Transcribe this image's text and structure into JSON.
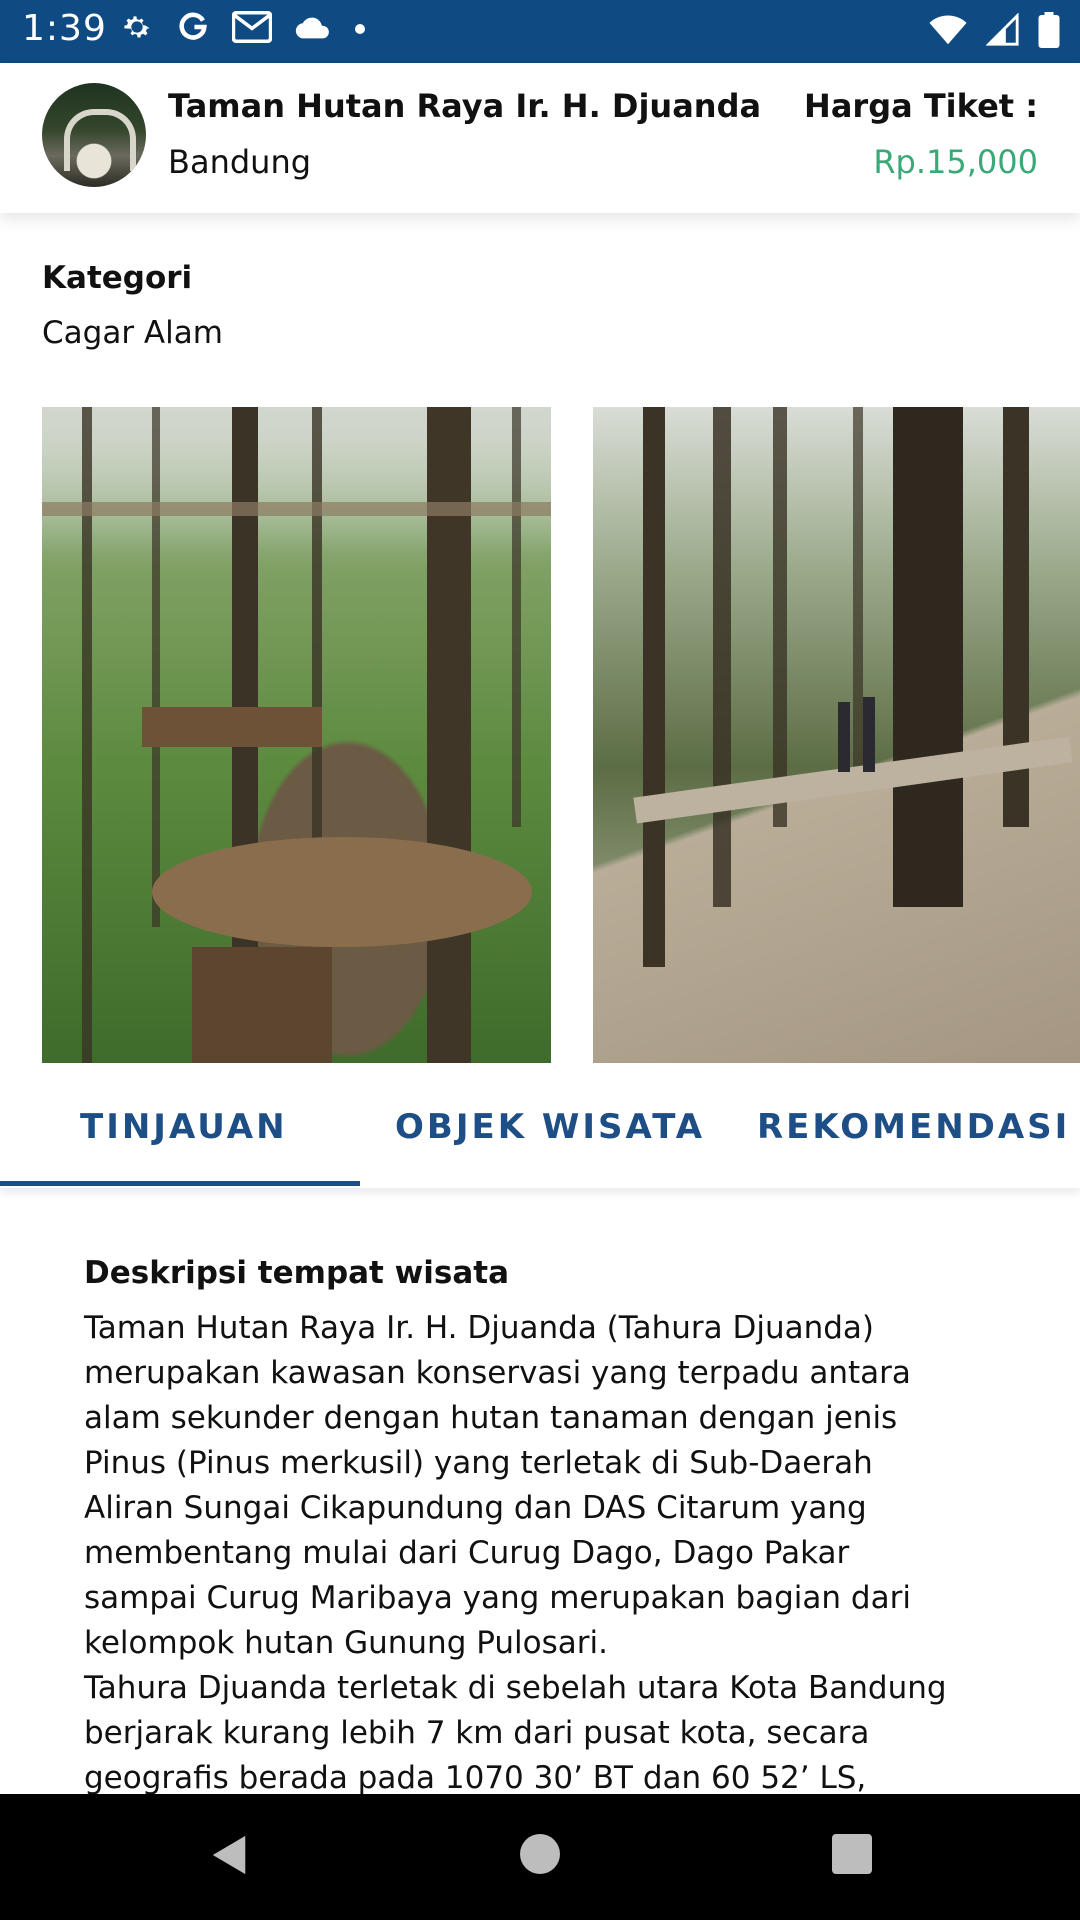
{
  "status_bar": {
    "time": "1:39",
    "icons_left": [
      "gear-icon",
      "google-icon",
      "gmail-icon",
      "cloud-icon",
      "dot-icon"
    ],
    "icons_right": [
      "wifi-icon",
      "signal-icon",
      "battery-icon"
    ],
    "background": "#0f4a82"
  },
  "header": {
    "title": "Taman Hutan Raya Ir. H. Djuanda",
    "city": "Bandung",
    "price_label": "Harga Tiket :",
    "price_value": "Rp.15,000",
    "price_color": "#3aa877"
  },
  "category": {
    "label": "Kategori",
    "value": "Cagar Alam"
  },
  "tabs": [
    {
      "label": "TINJAUAN",
      "active": true
    },
    {
      "label": "OBJEK WISATA",
      "active": false
    },
    {
      "label": "REKOMENDASI",
      "active": false
    }
  ],
  "description": {
    "title": "Deskripsi tempat wisata",
    "body": "Taman Hutan Raya Ir. H. Djuanda (Tahura Djuanda)\nmerupakan kawasan konservasi yang terpadu antara\nalam sekunder dengan hutan tanaman dengan jenis\nPinus (Pinus merkusil) yang terletak di Sub-Daerah\nAliran Sungai Cikapundung dan DAS Citarum yang\nmembentang mulai dari Curug Dago, Dago Pakar\nsampai Curug Maribaya yang merupakan bagian dari\nkelompok hutan Gunung Pulosari.\nTahura Djuanda terletak di sebelah utara Kota Bandung\nberjarak kurang lebih 7 km dari pusat kota, secara\ngeografis berada pada 1070 30’ BT dan 60 52’ LS,"
  },
  "colors": {
    "accent": "#1e4e86",
    "price": "#3aa877"
  }
}
